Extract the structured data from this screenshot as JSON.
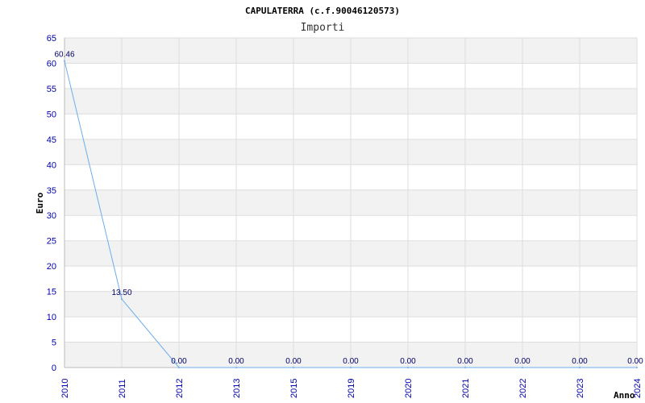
{
  "chart_data": {
    "type": "line",
    "title": "CAPULATERRA (c.f.90046120573)",
    "subtitle": "Importi",
    "xlabel": "Anno",
    "ylabel": "Euro",
    "categories": [
      "2010",
      "2011",
      "2012",
      "2013",
      "2015",
      "2019",
      "2020",
      "2021",
      "2022",
      "2023",
      "2024"
    ],
    "values": [
      60.46,
      13.5,
      0.0,
      0.0,
      0.0,
      0.0,
      0.0,
      0.0,
      0.0,
      0.0,
      0.0
    ],
    "data_labels": [
      "60.46",
      "13.50",
      "0.00",
      "0.00",
      "0.00",
      "0.00",
      "0.00",
      "0.00",
      "0.00",
      "0.00",
      "0.00"
    ],
    "ylim": [
      0,
      65
    ],
    "yticks": [
      0,
      5,
      10,
      15,
      20,
      25,
      30,
      35,
      40,
      45,
      50,
      55,
      60,
      65
    ],
    "grid": true,
    "colors": {
      "line": "#6aaef0",
      "band": "#f2f2f2",
      "grid": "#dddddd",
      "tick": "#0000aa",
      "label": "#000066"
    }
  }
}
